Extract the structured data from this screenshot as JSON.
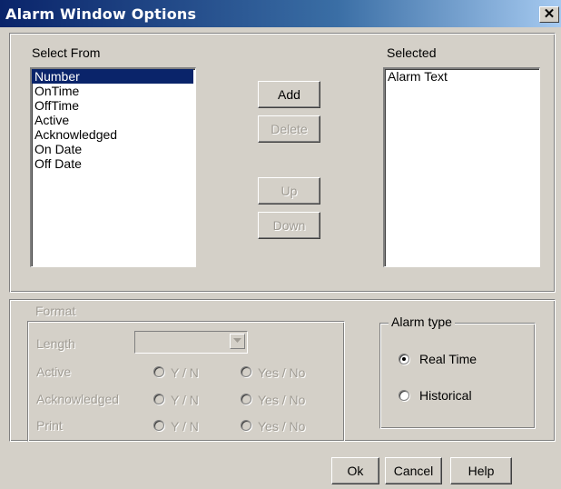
{
  "window": {
    "title": "Alarm Window Options",
    "close_glyph": "✕"
  },
  "select_from": {
    "label": "Select From",
    "items": [
      "Number",
      "OnTime",
      "OffTime",
      "Active",
      "Acknowledged",
      "On Date",
      "Off Date"
    ],
    "selected_item": "Number"
  },
  "selected": {
    "label": "Selected",
    "items": [
      "Alarm Text"
    ]
  },
  "buttons": {
    "add": "Add",
    "delete": "Delete",
    "up": "Up",
    "down": "Down",
    "ok": "Ok",
    "cancel": "Cancel",
    "help": "Help"
  },
  "format": {
    "label": "Format",
    "length_label": "Length",
    "length_value": "",
    "rows": [
      {
        "label": "Active",
        "option1": "Y / N",
        "option2": "Yes / No"
      },
      {
        "label": "Acknowledged",
        "option1": "Y / N",
        "option2": "Yes / No"
      },
      {
        "label": "Print",
        "option1": "Y / N",
        "option2": "Yes / No"
      }
    ]
  },
  "alarm_type": {
    "label": "Alarm type",
    "options": [
      "Real Time",
      "Historical"
    ],
    "selected": "Real Time"
  },
  "colors": {
    "dialog_bg": "#d4d0c8",
    "title_start": "#0a246a",
    "title_end": "#a6caf0",
    "selection_bg": "#0a246a",
    "disabled_text": "#a09c94"
  }
}
